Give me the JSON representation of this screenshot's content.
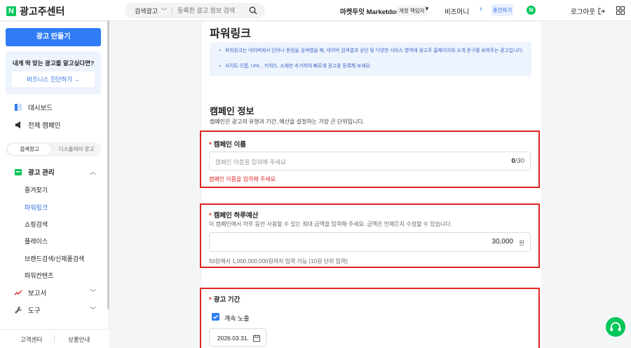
{
  "header": {
    "logo_letter": "N",
    "logo_text": "광고주센터",
    "search_type": "검색광고",
    "search_placeholder": "등록한 광고 정보 검색",
    "account_name": "마켓두잇 Marketdoit",
    "account_role": "계정 책임자",
    "bizmoney_label": "비즈머니",
    "charge_label": "충전하기",
    "naver_badge": "N",
    "logout_label": "로그아웃"
  },
  "sidebar": {
    "create_button": "광고 만들기",
    "reco_text": "내게 딱 맞는 광고를 알고싶다면?",
    "diag_button": "비즈니스 진단하기 →",
    "dashboard": "대시보드",
    "all_campaigns": "전체 캠페인",
    "tab_search": "검색광고",
    "tab_display": "디스플레이 광고",
    "ad_manage": "광고 관리",
    "sub_items": [
      "즐겨찾기",
      "파워링크",
      "쇼핑검색",
      "플레이스",
      "브랜드검색/신제품검색",
      "파워컨텐츠"
    ],
    "reports": "보고서",
    "tools": "도구",
    "footer_left": "고객센터",
    "footer_right": "상품안내"
  },
  "main": {
    "page_title": "파워링크",
    "info_lines": [
      "파워링크는 네이버에서 단어나 문장을 검색했을 때, 네이버 검색결과 상단 및 다양한 서비스 영역에 광고주 홈페이지와 소개 문구를 보여주는 광고입니다.",
      "사이트 이름, URL , 키워드, 소재만 추가하여 빠르게 광고를 등록해 보세요."
    ],
    "section_title": "캠페인 정보",
    "section_desc": "캠페인은 광고의 유형과 기간, 예산을 설정하는 가장 큰 단위입니다.",
    "name_field": {
      "required_mark": "*",
      "label": "캠페인 이름",
      "placeholder": "캠페인 이름을 입력해 주세요",
      "count": "0",
      "max": "/30",
      "error": "캠페인 이름을 입력해 주세요."
    },
    "budget_field": {
      "required_mark": "*",
      "label": "캠페인 하루예산",
      "desc": "이 캠페인에서 하루 동안 사용할 수 있는 최대 금액을 입력해 주세요. 금액은 언제든지 수정할 수 있습니다.",
      "value": "30,000",
      "unit": "원",
      "help": "50원에서 1,000,000,000원까지 입력 가능 (10원 단위 입력)"
    },
    "period_field": {
      "required_mark": "*",
      "label": "광고 기간",
      "continuous_label": "계속 노출",
      "continuous_checked": true,
      "start_date": "2026.03.31."
    }
  },
  "colors": {
    "brand_green": "#03c75a",
    "primary_blue": "#2f7cf6",
    "error_red": "#e02424"
  }
}
